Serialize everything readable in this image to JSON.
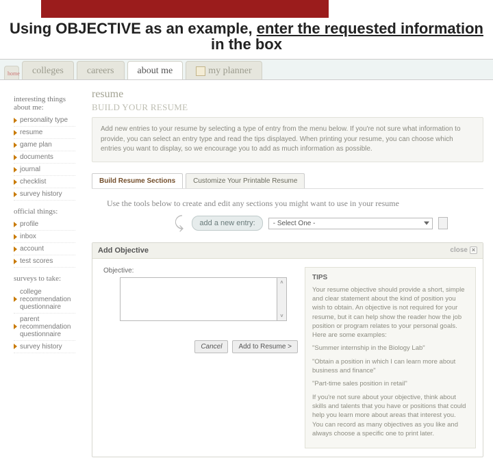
{
  "slide": {
    "title_pre": "Using OBJECTIVE as an example, ",
    "title_mid": "enter the requested information",
    "title_post": " in the box"
  },
  "nav": {
    "home": "home",
    "tabs": [
      "colleges",
      "careers",
      "about me",
      "my planner"
    ],
    "active": 2
  },
  "sidebar": {
    "head1": "interesting things about me:",
    "list1": [
      "personality type",
      "resume",
      "game plan",
      "documents",
      "journal",
      "checklist",
      "survey history"
    ],
    "head2": "official things:",
    "list2": [
      "profile",
      "inbox",
      "account",
      "test scores"
    ],
    "head3": "surveys to take:",
    "list3": [
      "college recommendation questionnaire",
      "parent recommendation questionnaire",
      "survey history"
    ]
  },
  "main": {
    "page_head": "resume",
    "page_sub": "BUILD YOUR RESUME",
    "info": "Add new entries to your resume by selecting a type of entry from the menu below. If you're not sure what information to provide, you can select an entry type and read the tips displayed. When printing your resume, you can choose which entries you want to display, so we encourage you to add as much information as possible.",
    "subtab1": "Build Resume Sections",
    "subtab2": "Customize Your Printable Resume",
    "hint": "Use the tools below to create and edit any sections you might want to use in your resume",
    "add_label": "add a new entry:",
    "select_value": "- Select One -",
    "obj_title": "Add Objective",
    "close_label": "close",
    "field_label": "Objective:",
    "cancel": "Cancel",
    "add_btn": "Add to Resume >",
    "tips_title": "TIPS",
    "tips_p1": "Your resume objective should provide a short, simple and clear statement about the kind of position you wish to obtain. An objective is not required for your resume, but it can help show the reader how the job position or program relates to your personal goals. Here are some examples:",
    "tips_ex1": "\"Summer internship in the Biology Lab\"",
    "tips_ex2": "\"Obtain a position in which I can learn more about business and finance\"",
    "tips_ex3": "\"Part-time sales position in retail\"",
    "tips_p2": "If you're not sure about your objective, think about skills and talents that you have or positions that could help you learn more about areas that interest you. You can record as many objectives as you like and always choose a specific one to print later."
  }
}
